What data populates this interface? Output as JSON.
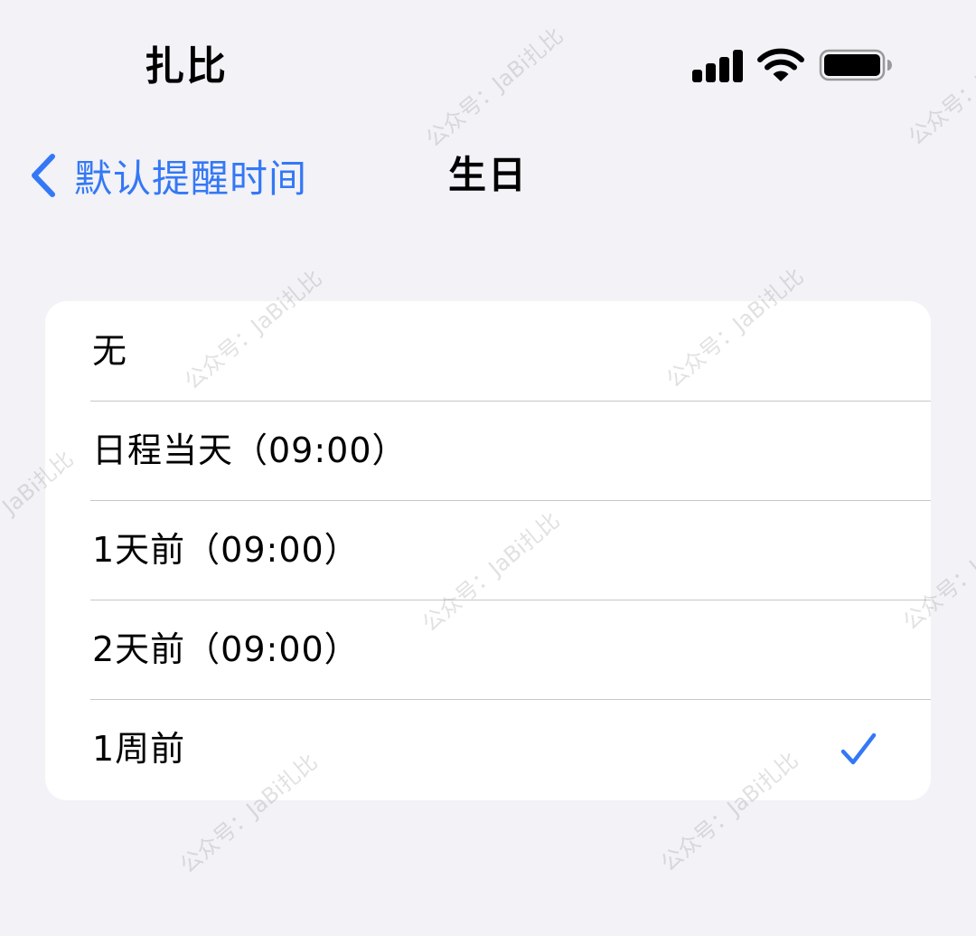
{
  "status_bar": {
    "carrier": "扎比",
    "icons": [
      "cellular-signal-icon",
      "wifi-icon",
      "battery-icon"
    ]
  },
  "nav": {
    "back_label": "默认提醒时间",
    "title": "生日"
  },
  "options": [
    {
      "label": "无",
      "selected": false
    },
    {
      "label": "日程当天（09:00）",
      "selected": false
    },
    {
      "label": "1天前（09:00）",
      "selected": false
    },
    {
      "label": "2天前（09:00）",
      "selected": false
    },
    {
      "label": "1周前",
      "selected": true
    }
  ],
  "watermark": "公众号：JaBi扎比",
  "colors": {
    "accent": "#3478f6",
    "background": "#f2f2f7",
    "card": "#ffffff",
    "separator": "#c8c8cc"
  }
}
